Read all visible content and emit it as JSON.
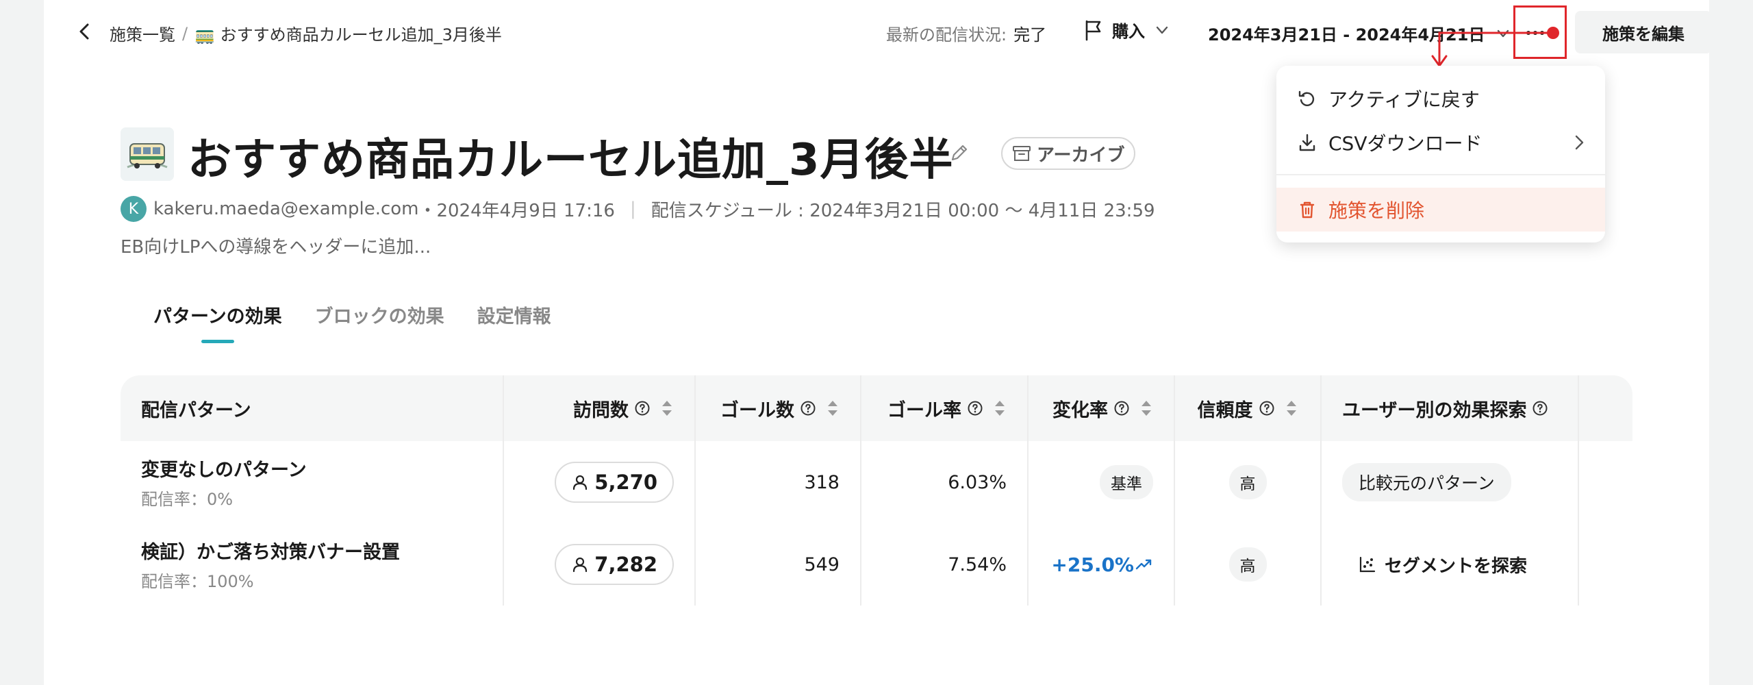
{
  "topbar": {
    "breadcrumb_root": "施策一覧",
    "breadcrumb_separator": "/",
    "breadcrumb_current": "🚃 おすすめ商品カルーセル追加_3月後半",
    "status_label": "最新の配信状況:",
    "status_value": "完了",
    "goal_label": "購入",
    "date_range": "2024年3月21日 - 2024年4月21日",
    "more_label": "···",
    "edit_button": "施策を編集"
  },
  "header": {
    "title": "おすすめ商品カルーセル追加_3月後半",
    "archive_badge": "アーカイブ",
    "avatar_initial": "K",
    "author_email": "kakeru.maeda@example.com",
    "updated_at": "・2024年4月9日 17:16",
    "divider": "|",
    "schedule": "配信スケジュール : 2024年3月21日 00:00 〜 4月11日 23:59",
    "description": "EB向けLPへの導線をヘッダーに追加..."
  },
  "tabs": [
    {
      "label": "パターンの効果",
      "active": true
    },
    {
      "label": "ブロックの効果",
      "active": false
    },
    {
      "label": "設定情報",
      "active": false
    }
  ],
  "table": {
    "headers": {
      "pattern": "配信パターン",
      "visits": "訪問数",
      "goals": "ゴール数",
      "goal_rate": "ゴール率",
      "change_rate": "変化率",
      "confidence": "信頼度",
      "segment": "ユーザー別の効果探索"
    },
    "rows": [
      {
        "name": "変更なしのパターン",
        "rate": "配信率：0%",
        "visits": "5,270",
        "goals": "318",
        "goal_rate": "6.03%",
        "change": "基準",
        "confidence": "高",
        "segment": "比較元のパターン"
      },
      {
        "name": "検証）かご落ち対策バナー設置",
        "rate": "配信率：100%",
        "visits": "7,282",
        "goals": "549",
        "goal_rate": "7.54%",
        "change": "+25.0%",
        "confidence": "高",
        "segment": "セグメントを探索"
      }
    ]
  },
  "menu": {
    "items": [
      {
        "label": "アクティブに戻す",
        "icon": "undo-icon"
      },
      {
        "label": "CSVダウンロード",
        "icon": "download-icon"
      },
      {
        "label": "施策を削除",
        "icon": "trash-icon"
      }
    ]
  },
  "colors": {
    "accent": "#25a9b9",
    "danger": "#e2542f",
    "uplift": "#1a73c8",
    "annotation": "#e0262b"
  }
}
